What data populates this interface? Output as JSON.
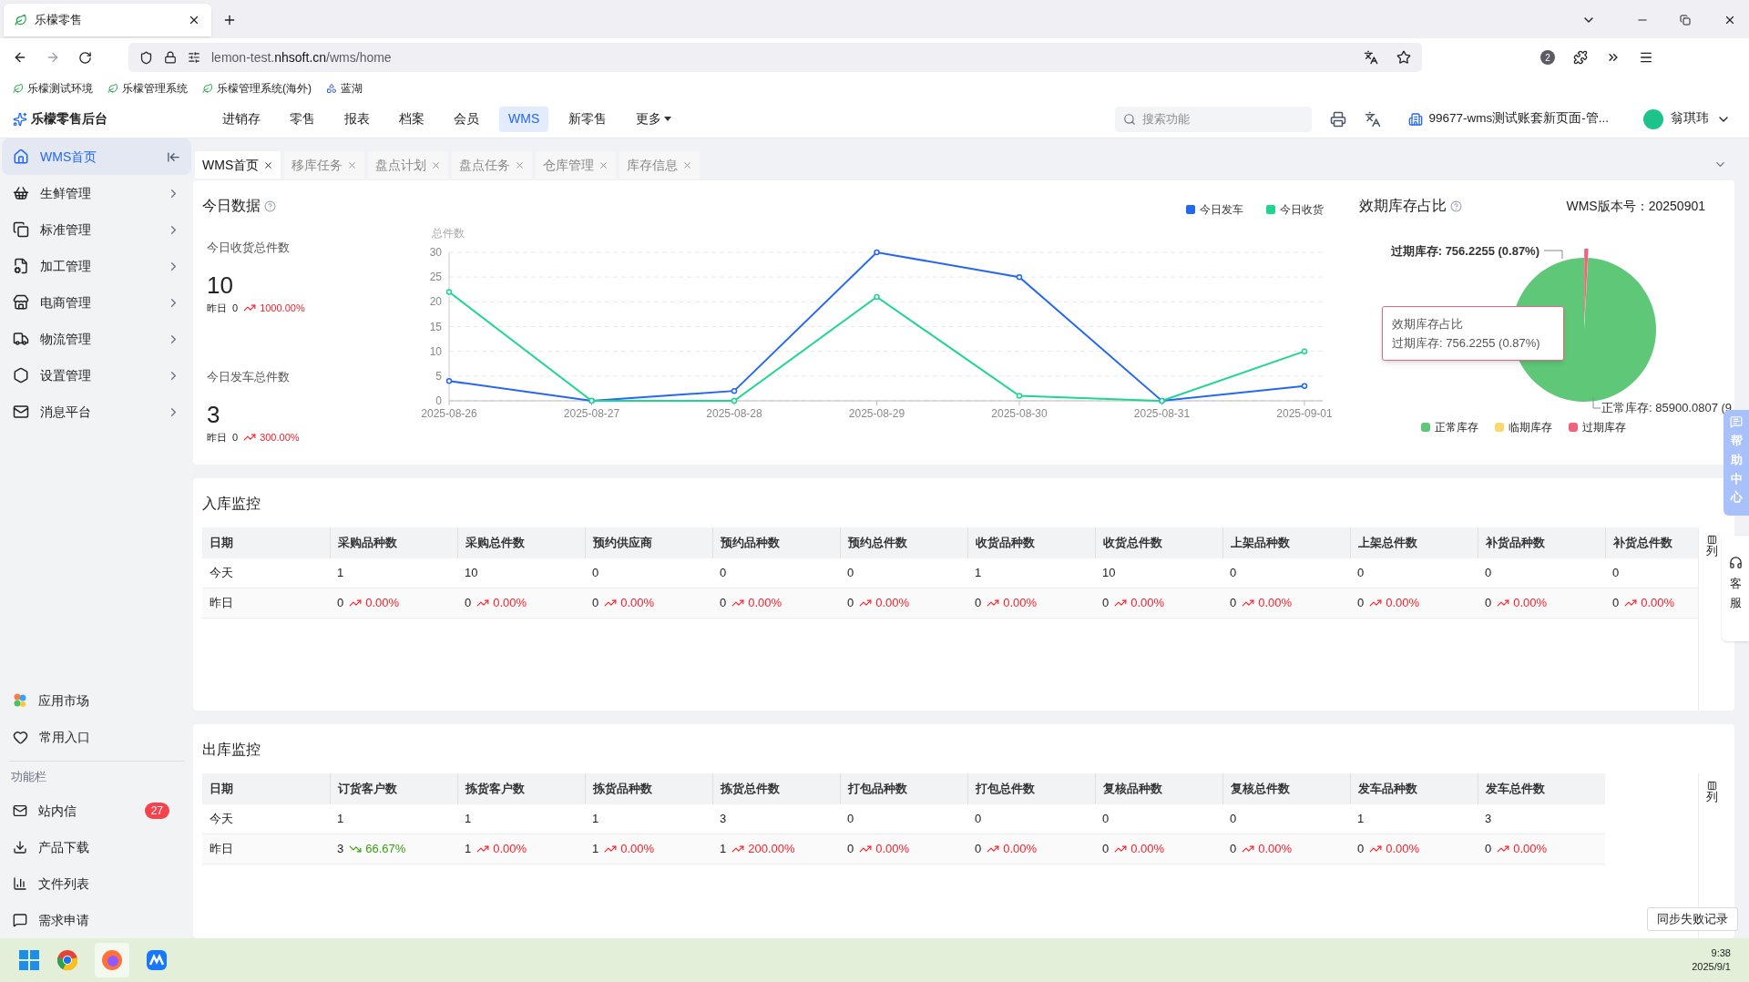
{
  "browser": {
    "tab_title": "乐檬零售",
    "url": {
      "prefix": "lemon-test.",
      "domain": "nhsoft.cn",
      "path": "/wms/home"
    },
    "notification_count": "2",
    "bookmarks": [
      {
        "label": "乐檬测试环境"
      },
      {
        "label": "乐檬管理系统"
      },
      {
        "label": "乐檬管理系统(海外)"
      },
      {
        "label": "蓝湖"
      }
    ]
  },
  "app": {
    "brand": "乐檬零售后台",
    "search_placeholder": "搜索功能",
    "account": "99677-wms测试账套新页面-管...",
    "user": "翁琪玮",
    "nav": [
      {
        "label": "进销存",
        "selected": false,
        "kind": "link"
      },
      {
        "label": "零售",
        "selected": false,
        "kind": "link"
      },
      {
        "label": "报表",
        "selected": false,
        "kind": "link"
      },
      {
        "label": "档案",
        "selected": false,
        "kind": "link"
      },
      {
        "label": "会员",
        "selected": false,
        "kind": "link"
      },
      {
        "label": "WMS",
        "selected": true,
        "kind": "link"
      },
      {
        "label": "新零售",
        "selected": false,
        "kind": "link"
      },
      {
        "label": "更多",
        "selected": false,
        "kind": "menu"
      }
    ]
  },
  "sidebar": {
    "items": [
      {
        "label": "WMS首页",
        "selected": true,
        "expandable": false
      },
      {
        "label": "生鲜管理",
        "selected": false,
        "expandable": true
      },
      {
        "label": "标准管理",
        "selected": false,
        "expandable": true
      },
      {
        "label": "加工管理",
        "selected": false,
        "expandable": true
      },
      {
        "label": "电商管理",
        "selected": false,
        "expandable": true
      },
      {
        "label": "物流管理",
        "selected": false,
        "expandable": true
      },
      {
        "label": "设置管理",
        "selected": false,
        "expandable": true
      },
      {
        "label": "消息平台",
        "selected": false,
        "expandable": true
      }
    ],
    "shortcuts": [
      {
        "label": "应用市场"
      },
      {
        "label": "常用入口"
      }
    ],
    "section_title": "功能栏",
    "tools": [
      {
        "label": "站内信",
        "badge": "27"
      },
      {
        "label": "产品下载"
      },
      {
        "label": "文件列表"
      },
      {
        "label": "需求申请"
      }
    ]
  },
  "page_tabs": [
    {
      "label": "WMS首页",
      "selected": true
    },
    {
      "label": "移库任务",
      "selected": false
    },
    {
      "label": "盘点计划",
      "selected": false
    },
    {
      "label": "盘点任务",
      "selected": false
    },
    {
      "label": "仓库管理",
      "selected": false
    },
    {
      "label": "库存信息",
      "selected": false
    }
  ],
  "today": {
    "title": "今日数据",
    "stats": [
      {
        "label": "今日收货总件数",
        "value": "10",
        "prev_label": "昨日",
        "prev_value": "0",
        "change": "1000.00%",
        "rising": true
      },
      {
        "label": "今日发车总件数",
        "value": "3",
        "prev_label": "昨日",
        "prev_value": "0",
        "change": "300.00%",
        "rising": true
      }
    ],
    "chart_data": {
      "type": "line",
      "ylabel": "总件数",
      "grid": true,
      "legend": true,
      "categories": [
        "2025-08-26",
        "2025-08-27",
        "2025-08-28",
        "2025-08-29",
        "2025-08-30",
        "2025-08-31",
        "2025-09-01"
      ],
      "ylim": [
        0,
        30
      ],
      "yticks": [
        0,
        5,
        10,
        15,
        20,
        25,
        30
      ],
      "series": [
        {
          "name": "今日发车",
          "color": "#2468f2",
          "marker": "circle",
          "values": [
            4,
            0,
            2,
            30,
            25,
            0,
            3
          ]
        },
        {
          "name": "今日收货",
          "color": "#1ed68f",
          "marker": "circle",
          "values": [
            22,
            0,
            0,
            21,
            1,
            0,
            10
          ]
        }
      ]
    }
  },
  "expiry": {
    "title": "效期库存占比",
    "version_label": "WMS版本号：",
    "version": "20250901",
    "chart_data": {
      "type": "pie",
      "categories": [
        "正常库存",
        "临期库存",
        "过期库存"
      ],
      "colors": [
        "#5ec878",
        "#fad86c",
        "#f2637b"
      ],
      "legend": true,
      "series": [
        {
          "values": [
            99.13,
            0,
            0.87
          ]
        }
      ],
      "value_labels": [
        "正常库存: 85900.0807 (9",
        null,
        "过期库存: 756.2255 (0.87%)"
      ]
    },
    "tooltip": {
      "title": "效期库存占比",
      "text": "过期库存: 756.2255 (0.87%)"
    }
  },
  "inbound": {
    "title": "入库监控",
    "column_button": "列",
    "columns": [
      "日期",
      "采购品种数",
      "采购总件数",
      "预约供应商",
      "预约品种数",
      "预约总件数",
      "收货品种数",
      "收货总件数",
      "上架品种数",
      "上架总件数",
      "补货品种数",
      "补货总件数"
    ],
    "rows": [
      {
        "cells": [
          {
            "value": "今天"
          },
          {
            "value": "1"
          },
          {
            "value": "10"
          },
          {
            "value": "0"
          },
          {
            "value": "0"
          },
          {
            "value": "0"
          },
          {
            "value": "1"
          },
          {
            "value": "10"
          },
          {
            "value": "0"
          },
          {
            "value": "0"
          },
          {
            "value": "0"
          },
          {
            "value": "0"
          }
        ]
      },
      {
        "cells": [
          {
            "value": "昨日"
          },
          {
            "value": "0",
            "change": "0.00%",
            "rising": true
          },
          {
            "value": "0",
            "change": "0.00%",
            "rising": true
          },
          {
            "value": "0",
            "change": "0.00%",
            "rising": true
          },
          {
            "value": "0",
            "change": "0.00%",
            "rising": true
          },
          {
            "value": "0",
            "change": "0.00%",
            "rising": true
          },
          {
            "value": "0",
            "change": "0.00%",
            "rising": true
          },
          {
            "value": "0",
            "change": "0.00%",
            "rising": true
          },
          {
            "value": "0",
            "change": "0.00%",
            "rising": true
          },
          {
            "value": "0",
            "change": "0.00%",
            "rising": true
          },
          {
            "value": "0",
            "change": "0.00%",
            "rising": true
          },
          {
            "value": "0",
            "change": "0.00%",
            "rising": true
          }
        ]
      }
    ]
  },
  "outbound": {
    "title": "出库监控",
    "column_button": "列",
    "columns": [
      "日期",
      "订货客户数",
      "拣货客户数",
      "拣货品种数",
      "拣货总件数",
      "打包品种数",
      "打包总件数",
      "复核品种数",
      "复核总件数",
      "发车品种数",
      "发车总件数"
    ],
    "rows": [
      {
        "cells": [
          {
            "value": "今天"
          },
          {
            "value": "1"
          },
          {
            "value": "1"
          },
          {
            "value": "1"
          },
          {
            "value": "3"
          },
          {
            "value": "0"
          },
          {
            "value": "0"
          },
          {
            "value": "0"
          },
          {
            "value": "0"
          },
          {
            "value": "1"
          },
          {
            "value": "3"
          }
        ]
      },
      {
        "cells": [
          {
            "value": "昨日"
          },
          {
            "value": "3",
            "change": "66.67%",
            "rising": false
          },
          {
            "value": "1",
            "change": "0.00%",
            "rising": true
          },
          {
            "value": "1",
            "change": "0.00%",
            "rising": true
          },
          {
            "value": "1",
            "change": "200.00%",
            "rising": true
          },
          {
            "value": "0",
            "change": "0.00%",
            "rising": true
          },
          {
            "value": "0",
            "change": "0.00%",
            "rising": true
          },
          {
            "value": "0",
            "change": "0.00%",
            "rising": true
          },
          {
            "value": "0",
            "change": "0.00%",
            "rising": true
          },
          {
            "value": "0",
            "change": "0.00%",
            "rising": true
          },
          {
            "value": "0",
            "change": "0.00%",
            "rising": true
          }
        ]
      }
    ]
  },
  "floating": {
    "help": "帮助中心",
    "service": "客服",
    "sync_button": "同步失败记录"
  },
  "taskbar": {
    "time": "9:38",
    "date": "2025/9/1"
  }
}
